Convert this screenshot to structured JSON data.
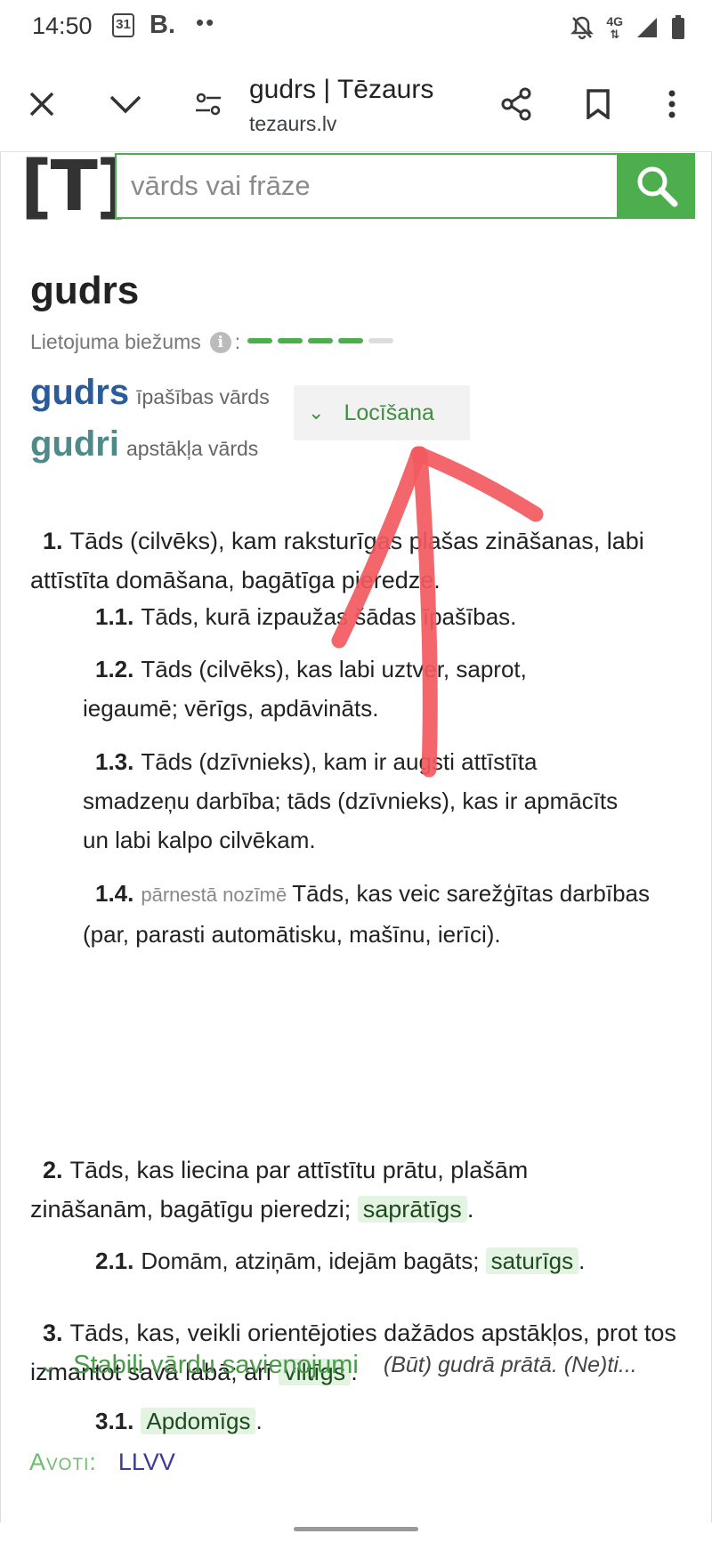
{
  "status_bar": {
    "time": "14:50",
    "calendar_day": "31",
    "b_badge": "B.",
    "dots": "••",
    "net": "4G"
  },
  "browser": {
    "page_title": "gudrs | Tēzaurs",
    "url": "tezaurs.lv",
    "icons": [
      "close-icon",
      "chevron-down-icon",
      "site-settings-icon",
      "share-icon",
      "bookmark-icon",
      "more-vert-icon"
    ]
  },
  "site": {
    "logo": "[T]:",
    "search_placeholder": "vārds vai frāze",
    "accent_color": "#4cae4c"
  },
  "entry": {
    "headword": "gudrs",
    "frequency_label": "Lietojuma biežums",
    "frequency_colon": ":",
    "frequency_level": 4,
    "frequency_max": 5,
    "lemmas": [
      {
        "word": "gudrs",
        "pos": "īpašības vārds",
        "color": "#2a5b9a"
      },
      {
        "word": "gudri",
        "pos": "apstākļa vārds",
        "color": "#4e8a8a"
      }
    ],
    "declension_label": "Locīšana",
    "senses": [
      {
        "num": "1.",
        "text": "Tāds (cilvēks), kam raksturīgas plašas zināšanas, labi attīstīta domāšana, bagātīga pieredze."
      },
      {
        "num": "1.1.",
        "text": "Tāds, kurā izpaužas šādas īpašības."
      },
      {
        "num": "1.2.",
        "text": "Tāds (cilvēks), kas labi uztver, saprot, iegaumē; vērīgs, apdāvināts."
      },
      {
        "num": "1.3.",
        "text": "Tāds (dzīvnieks), kam ir augsti attīstīta smadzeņu darbība; tāds (dzīvnieks), kas ir apmācīts un labi kalpo cilvēkam."
      },
      {
        "num": "1.4.",
        "gloss": "pārnestā nozīmē",
        "text": "Tāds, kas veic sarežģītas darbības (par, parasti automātisku, mašīnu, ierīci)."
      },
      {
        "num": "2.",
        "text": "Tāds, kas liecina par attīstītu prātu, plašām zināšanām, bagātīgu pieredzi;",
        "synonym": "saprātīgs",
        "end": "."
      },
      {
        "num": "2.1.",
        "text": "Domām, atziņām, idejām bagāts;",
        "synonym": "saturīgs",
        "end": "."
      },
      {
        "num": "3.",
        "text": "Tāds, kas, veikli orientējoties dažādos apstākļos, prot tos izmantot savā labā; arī",
        "synonym": "viltīgs",
        "end": "."
      },
      {
        "num": "3.1.",
        "synonym": "Apdomīgs",
        "end": "."
      }
    ],
    "phrases_label": "Stabili vārdu savienojumi",
    "phrases_preview": "(Būt) gudrā prātā. (Ne)ti...",
    "sources_label": "Avoti:",
    "source": "LLVV"
  },
  "annotation": {
    "color": "#f25a5f",
    "points_to": "Locīšana"
  }
}
